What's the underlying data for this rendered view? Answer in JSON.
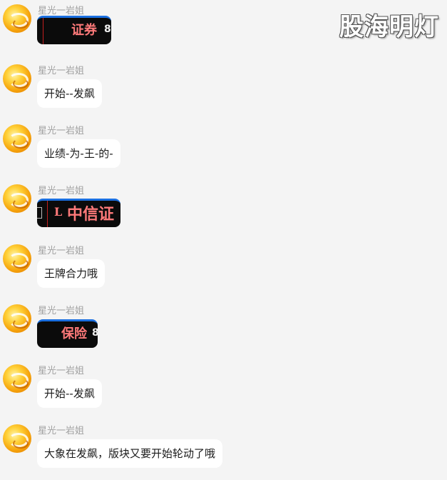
{
  "watermark": "股海明灯",
  "messages": [
    {
      "sender": "星光一岩姐",
      "type": "image",
      "stock": "证券",
      "number": "8"
    },
    {
      "sender": "星光一岩姐",
      "type": "text",
      "text": "开始--发飙"
    },
    {
      "sender": "星光一岩姐",
      "type": "text",
      "text": "业绩-为-王-的-"
    },
    {
      "sender": "星光一岩姐",
      "type": "image",
      "prefix": "L",
      "stock": "中信证"
    },
    {
      "sender": "星光一岩姐",
      "type": "text",
      "text": "王牌合力哦"
    },
    {
      "sender": "星光一岩姐",
      "type": "image",
      "stock": "保险",
      "number": "8"
    },
    {
      "sender": "星光一岩姐",
      "type": "text",
      "text": "开始--发飙"
    },
    {
      "sender": "星光一岩姐",
      "type": "text",
      "text": "大象在发飙，版块又要开始轮动了哦"
    }
  ]
}
